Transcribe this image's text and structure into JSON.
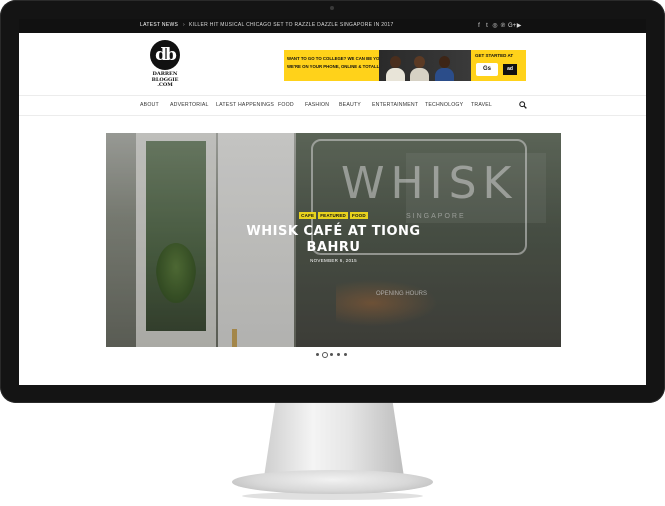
{
  "topbar": {
    "latest_label": "LATEST NEWS",
    "ticker_chevron": "›",
    "ticker_headline": "KILLER HIT MUSICAL CHICAGO SET TO RAZZLE DAZZLE SINGAPORE IN 2017",
    "social_icons": [
      "facebook-icon",
      "twitter-icon",
      "instagram-icon",
      "pinterest-icon",
      "google-plus-icon",
      "youtube-icon"
    ],
    "social_glyphs": [
      "f",
      "t",
      "◎",
      "℗",
      "G+",
      "▶"
    ]
  },
  "logo": {
    "mark": "db",
    "line1": "DARREN",
    "line2": "BLOGGIE",
    "line3": ".COM"
  },
  "ad_banner": {
    "line1": "WANT TO GO TO COLLEGE? WE CAN BE YOUR GUIDE.",
    "line2": "WE'RE ON YOUR PHONE, ONLINE & TOTALLY FREE",
    "cta": "GET STARTED AT",
    "partner_logo": "Gs",
    "partner_mark": "ad"
  },
  "nav": {
    "items": [
      "ABOUT",
      "ADVERTORIAL",
      "LATEST HAPPENINGS",
      "FOOD",
      "FASHION",
      "BEAUTY",
      "ENTERTAINMENT",
      "TECHNOLOGY",
      "TRAVEL"
    ],
    "search_icon": "search-icon"
  },
  "hero": {
    "categories": [
      "CAFE",
      "FEATURED",
      "FOOD"
    ],
    "title": "WHISK CAFÉ AT TIONG BAHRU",
    "date": "NOVEMBER 6, 2015",
    "sign_text": "WHISK",
    "sign_sub": "SINGAPORE",
    "sign_note": "OPENING HOURS"
  },
  "slider": {
    "dot_count": 5,
    "active_index": 1
  },
  "colors": {
    "topbar_bg": "#111111",
    "category_tag": "#e8d21e",
    "ad_yellow": "#ffd21a",
    "bezel": "#141414"
  }
}
